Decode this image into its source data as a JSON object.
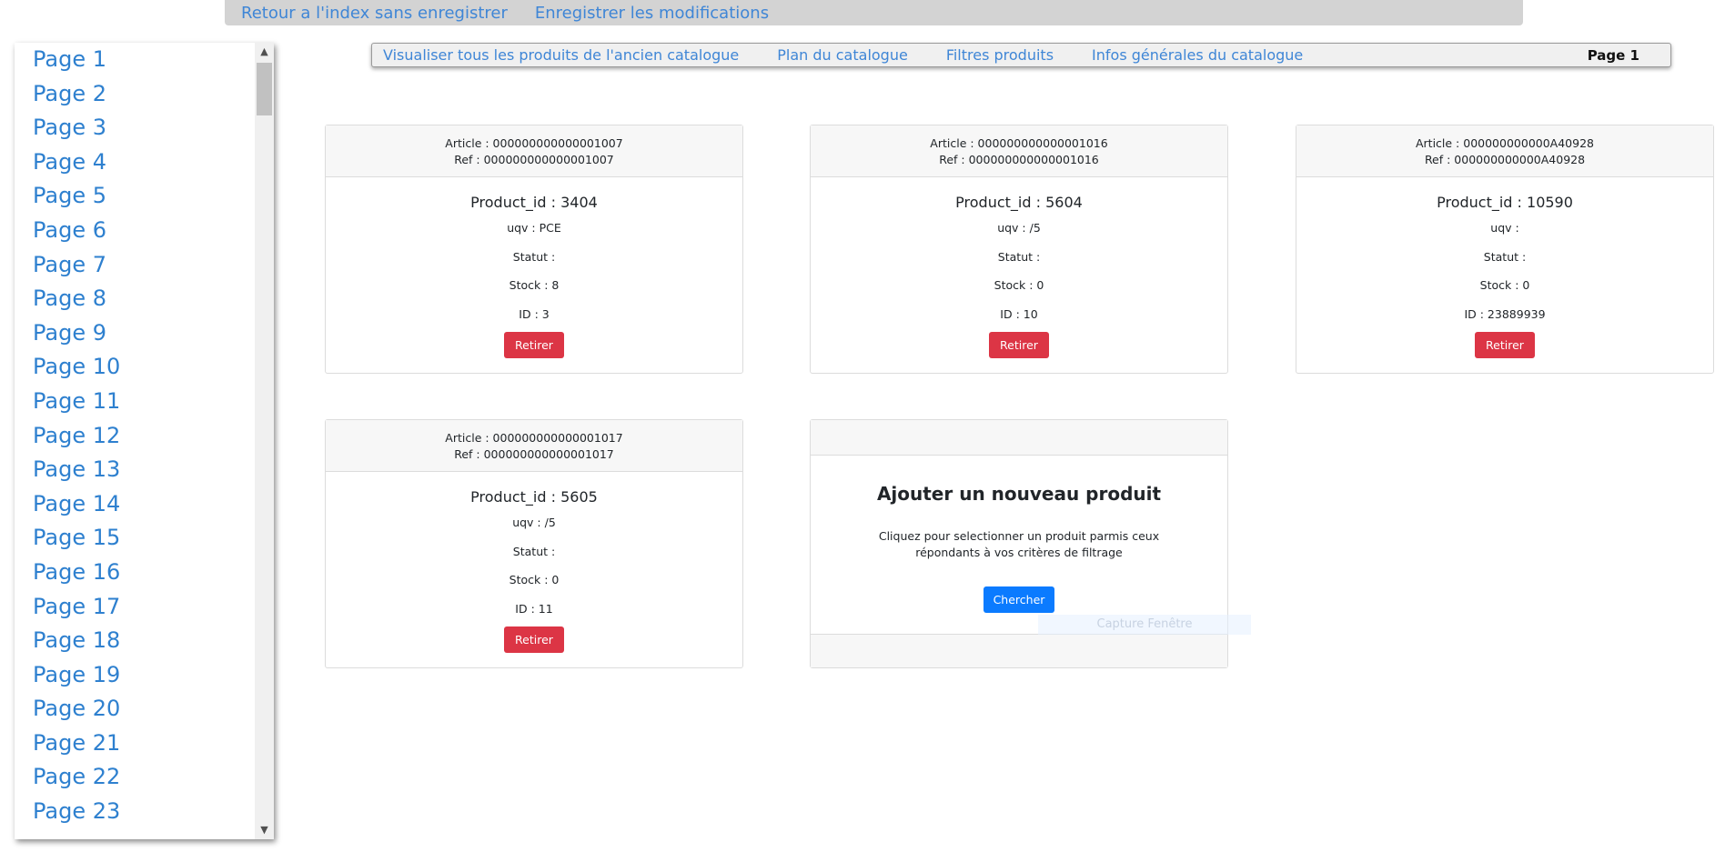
{
  "top_bar": {
    "back_label": "Retour a l'index sans enregistrer",
    "save_label": "Enregistrer les modifications"
  },
  "sidebar": {
    "items": [
      "Page 1",
      "Page 2",
      "Page 3",
      "Page 4",
      "Page 5",
      "Page 6",
      "Page 7",
      "Page 8",
      "Page 9",
      "Page 10",
      "Page 11",
      "Page 12",
      "Page 13",
      "Page 14",
      "Page 15",
      "Page 16",
      "Page 17",
      "Page 18",
      "Page 19",
      "Page 20",
      "Page 21",
      "Page 22",
      "Page 23"
    ]
  },
  "tabs": {
    "items": [
      "Visualiser tous les produits de l'ancien catalogue",
      "Plan du catalogue",
      "Filtres produits",
      "Infos générales du catalogue"
    ],
    "current_page": "Page 1"
  },
  "products": [
    {
      "article": "Article : 000000000000001007",
      "ref": "Ref : 000000000000001007",
      "product_id": "Product_id : 3404",
      "uqv": "uqv : PCE",
      "statut": "Statut :",
      "stock": "Stock : 8",
      "id": "ID : 3",
      "remove_label": "Retirer"
    },
    {
      "article": "Article : 000000000000001016",
      "ref": "Ref : 000000000000001016",
      "product_id": "Product_id : 5604",
      "uqv": "uqv : /5",
      "statut": "Statut :",
      "stock": "Stock : 0",
      "id": "ID : 10",
      "remove_label": "Retirer"
    },
    {
      "article": "Article : 000000000000A40928",
      "ref": "Ref : 000000000000A40928",
      "product_id": "Product_id : 10590",
      "uqv": "uqv :",
      "statut": "Statut :",
      "stock": "Stock : 0",
      "id": "ID : 23889939",
      "remove_label": "Retirer"
    },
    {
      "article": "Article : 000000000000001017",
      "ref": "Ref : 000000000000001017",
      "product_id": "Product_id : 5605",
      "uqv": "uqv : /5",
      "statut": "Statut :",
      "stock": "Stock : 0",
      "id": "ID : 11",
      "remove_label": "Retirer"
    }
  ],
  "add_product": {
    "title": "Ajouter un nouveau produit",
    "description": "Cliquez pour selectionner un produit parmis ceux répondants à vos critères de filtrage",
    "search_label": "Chercher"
  },
  "tooltip": {
    "text": "Capture Fenêtre"
  },
  "colors": {
    "link": "#3f86d6",
    "danger": "#dc3545",
    "primary": "#0b7bff"
  }
}
